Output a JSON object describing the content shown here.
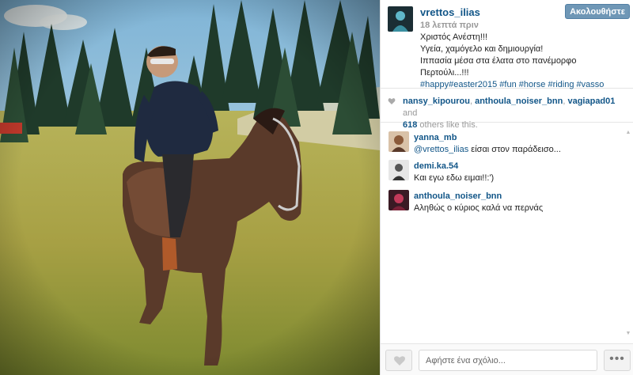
{
  "post": {
    "photo_alt": "Man in sunglasses and dark jacket riding a brown horse in a mountain meadow with fir trees"
  },
  "header": {
    "username": "vrettos_ilias",
    "time_ago": "18 λεπτά πριν",
    "follow_label": "Ακολουθήστε",
    "caption_lines": [
      "Χριστός Ανέστη!!!",
      "Υγεία, χαμόγελο και δημιουργία!",
      "Ιππασία μέσα στα έλατα στο πανέμορφο Περτούλι...!!!"
    ],
    "hashtags": "#happy#easter2015 #fun #horse #riding #vasso"
  },
  "likes": {
    "user1": "nansy_kipourou",
    "user2": "anthoula_noiser_bnn",
    "user3": "vagiapad01",
    "and": "and",
    "others": "618",
    "others_suffix": "others like this."
  },
  "comments": [
    {
      "user": "yanna_mb",
      "mention": "@vrettos_ilias",
      "text": " είσαι στον παράδεισο..."
    },
    {
      "user": "demi.ka.54",
      "mention": "",
      "text": "Και εγω εδω ειμαι!!:')"
    },
    {
      "user": "anthoula_noiser_bnn",
      "mention": "",
      "text": "Αληθώς ο κύριος καλά να περνάς"
    }
  ],
  "footer": {
    "comment_placeholder": "Αφήστε ένα σχόλιο...",
    "more_label": "•••"
  },
  "colors": {
    "link": "#125688",
    "follow_button": "#6f97b6"
  },
  "icons": {
    "likes": "heart-icon",
    "like_button": "heart-outline-icon",
    "scroll_up": "scroll-up-icon",
    "scroll_down": "scroll-down-icon"
  }
}
